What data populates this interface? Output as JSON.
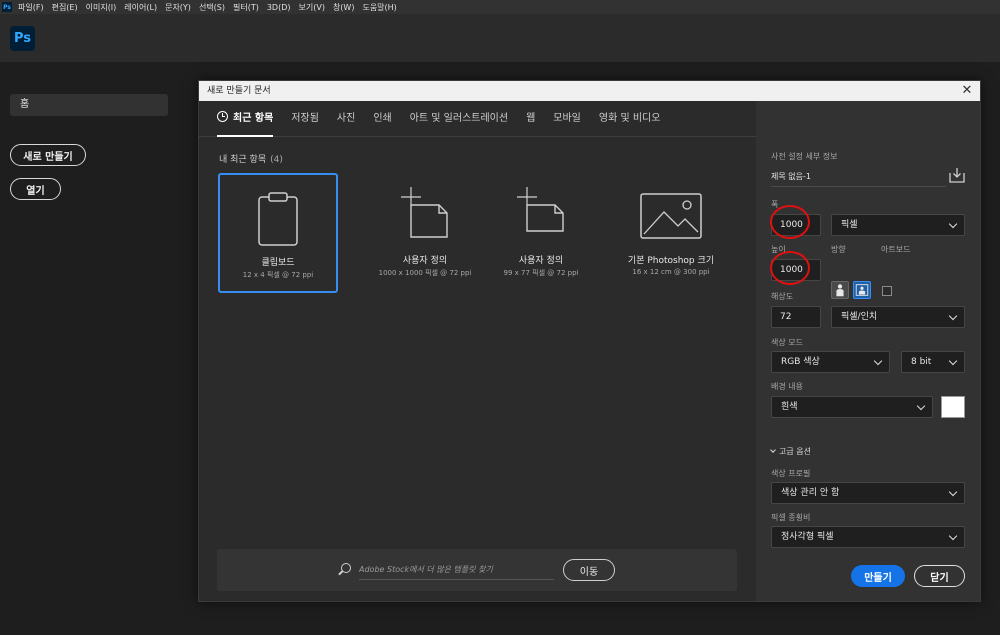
{
  "menubar": {
    "app_icon": "Ps",
    "items": [
      "파일(F)",
      "편집(E)",
      "이미지(I)",
      "레이어(L)",
      "문자(Y)",
      "선택(S)",
      "필터(T)",
      "3D(D)",
      "보기(V)",
      "창(W)",
      "도움말(H)"
    ]
  },
  "header": {
    "logo": "Ps"
  },
  "home": {
    "home_label": "홈",
    "new_button": "새로 만들기",
    "open_button": "열기"
  },
  "dialog": {
    "title": "새로 만들기 문서",
    "close_glyph": "✕",
    "tabs": [
      "최근 항목",
      "저장됨",
      "사진",
      "인쇄",
      "아트 및 일러스트레이션",
      "웹",
      "모바일",
      "영화 및 비디오"
    ],
    "recent_label": "내 최근 항목",
    "recent_count": "(4)",
    "presets": [
      {
        "name": "클립보드",
        "dims": "12 x 4 픽셀 @ 72 ppi",
        "icon": "clipboard-icon",
        "selected": true
      },
      {
        "name": "사용자 정의",
        "dims": "1000 x 1000 픽셀 @ 72 ppi",
        "icon": "custom-document-icon",
        "selected": false
      },
      {
        "name": "사용자 정의",
        "dims": "99 x 77 픽셀 @ 72 ppi",
        "icon": "custom-document-icon",
        "selected": false
      },
      {
        "name": "기본 Photoshop 크기",
        "dims": "16 x 12 cm @ 300 ppi",
        "icon": "image-icon",
        "selected": false
      }
    ],
    "search": {
      "placeholder": "Adobe Stock에서 더 많은 템플릿 찾기",
      "go_button": "이동"
    }
  },
  "preset_details": {
    "section_title": "사전 설정 세부 정보",
    "document_name": "제목 없음-1",
    "width_label": "폭",
    "width_value": "1000",
    "width_unit": "픽셀",
    "height_label": "높이",
    "height_value": "1000",
    "orientation_label": "방향",
    "artboard_label": "아트보드",
    "resolution_label": "해상도",
    "resolution_value": "72",
    "resolution_unit": "픽셀/인치",
    "color_mode_label": "색상 모드",
    "color_mode": "RGB 색상",
    "bit_depth": "8 bit",
    "background_label": "배경 내용",
    "background": "흰색",
    "background_color": "#ffffff",
    "advanced_label": "고급 옵션",
    "color_profile_label": "색상 프로필",
    "color_profile": "색상 관리 안 함",
    "pixel_aspect_label": "픽셀 종횡비",
    "pixel_aspect": "정사각형 픽셀",
    "create_button": "만들기",
    "close_button": "닫기"
  },
  "colors": {
    "accent": "#1473e6",
    "selection": "#378ef0",
    "annotation": "#e01010"
  }
}
